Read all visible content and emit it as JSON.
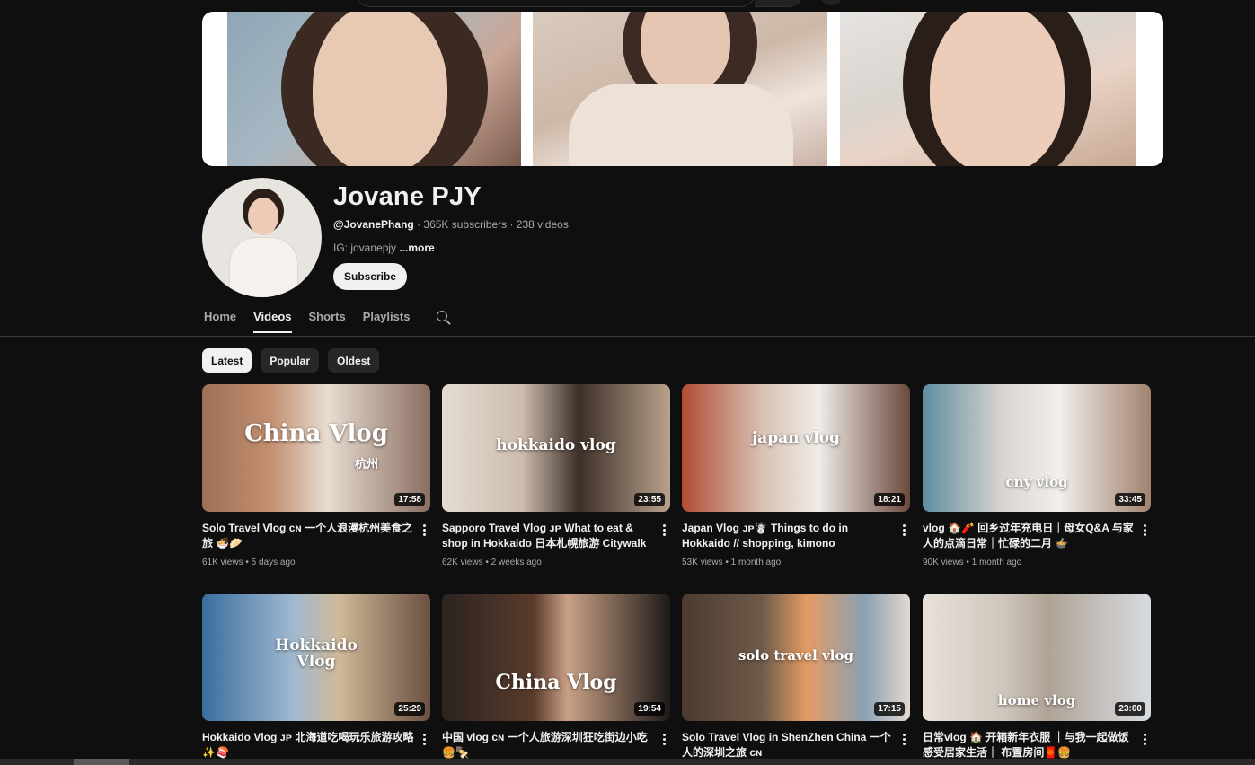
{
  "banner": {
    "alt": ""
  },
  "channel": {
    "name": "Jovane PJY",
    "handle": "@JovanePhang",
    "meta_rest": " · 365K subscribers · 238 videos",
    "description": "IG: jovanepjy ",
    "more_label": "...more",
    "subscribe_label": "Subscribe"
  },
  "tabs": [
    {
      "label": "Home"
    },
    {
      "label": "Videos"
    },
    {
      "label": "Shorts"
    },
    {
      "label": "Playlists"
    }
  ],
  "chips": [
    {
      "label": "Latest"
    },
    {
      "label": "Popular"
    },
    {
      "label": "Oldest"
    }
  ],
  "videos": [
    {
      "title": "Solo Travel Vlog ᴄɴ 一个人浪漫杭州美食之旅 🍜🥟",
      "views": "61K views",
      "age": "5 days ago",
      "duration": "17:58",
      "overlay": "China          Vlog",
      "overlay2": "杭州"
    },
    {
      "title": "Sapporo Travel Vlog ᴊᴘ What to eat & shop in Hokkaido 日本札幌旅游 Citywalk 🦞🍜",
      "views": "62K views",
      "age": "2 weeks ago",
      "duration": "23:55",
      "overlay": "hokkaido vlog",
      "overlay2": ""
    },
    {
      "title": "Japan Vlog ᴊᴘ☃️ Things to do in Hokkaido // shopping, kimono experience, seafood...",
      "views": "53K views",
      "age": "1 month ago",
      "duration": "18:21",
      "overlay": "japan          vlog",
      "overlay2": ""
    },
    {
      "title": "vlog 🏠🧨 回乡过年充电日｜母女Q&A 与家人的点滴日常｜忙碌的二月 🍲",
      "views": "90K views",
      "age": "1 month ago",
      "duration": "33:45",
      "overlay": "cny vlog",
      "overlay2": ""
    },
    {
      "title": "Hokkaido Vlog ᴊᴘ 北海道吃喝玩乐旅游攻略 ✨🍣",
      "views": "",
      "age": "",
      "duration": "25:29",
      "overlay": "Hokkaido",
      "overlay2": "Vlog"
    },
    {
      "title": "中国 vlog ᴄɴ 一个人旅游深圳狂吃街边小吃 🍔🍢",
      "views": "",
      "age": "",
      "duration": "19:54",
      "overlay": "China Vlog",
      "overlay2": ""
    },
    {
      "title": "Solo Travel Vlog in ShenZhen China 一个人的深圳之旅 ᴄɴ",
      "views": "",
      "age": "",
      "duration": "17:15",
      "overlay": "solo travel vlog",
      "overlay2": ""
    },
    {
      "title": "日常vlog 🏠 开箱新年衣服 ｜与我一起做饭感受居家生活｜ 布置房间🧧🍔",
      "views": "",
      "age": "",
      "duration": "23:00",
      "overlay": "home vlog",
      "overlay2": ""
    }
  ]
}
